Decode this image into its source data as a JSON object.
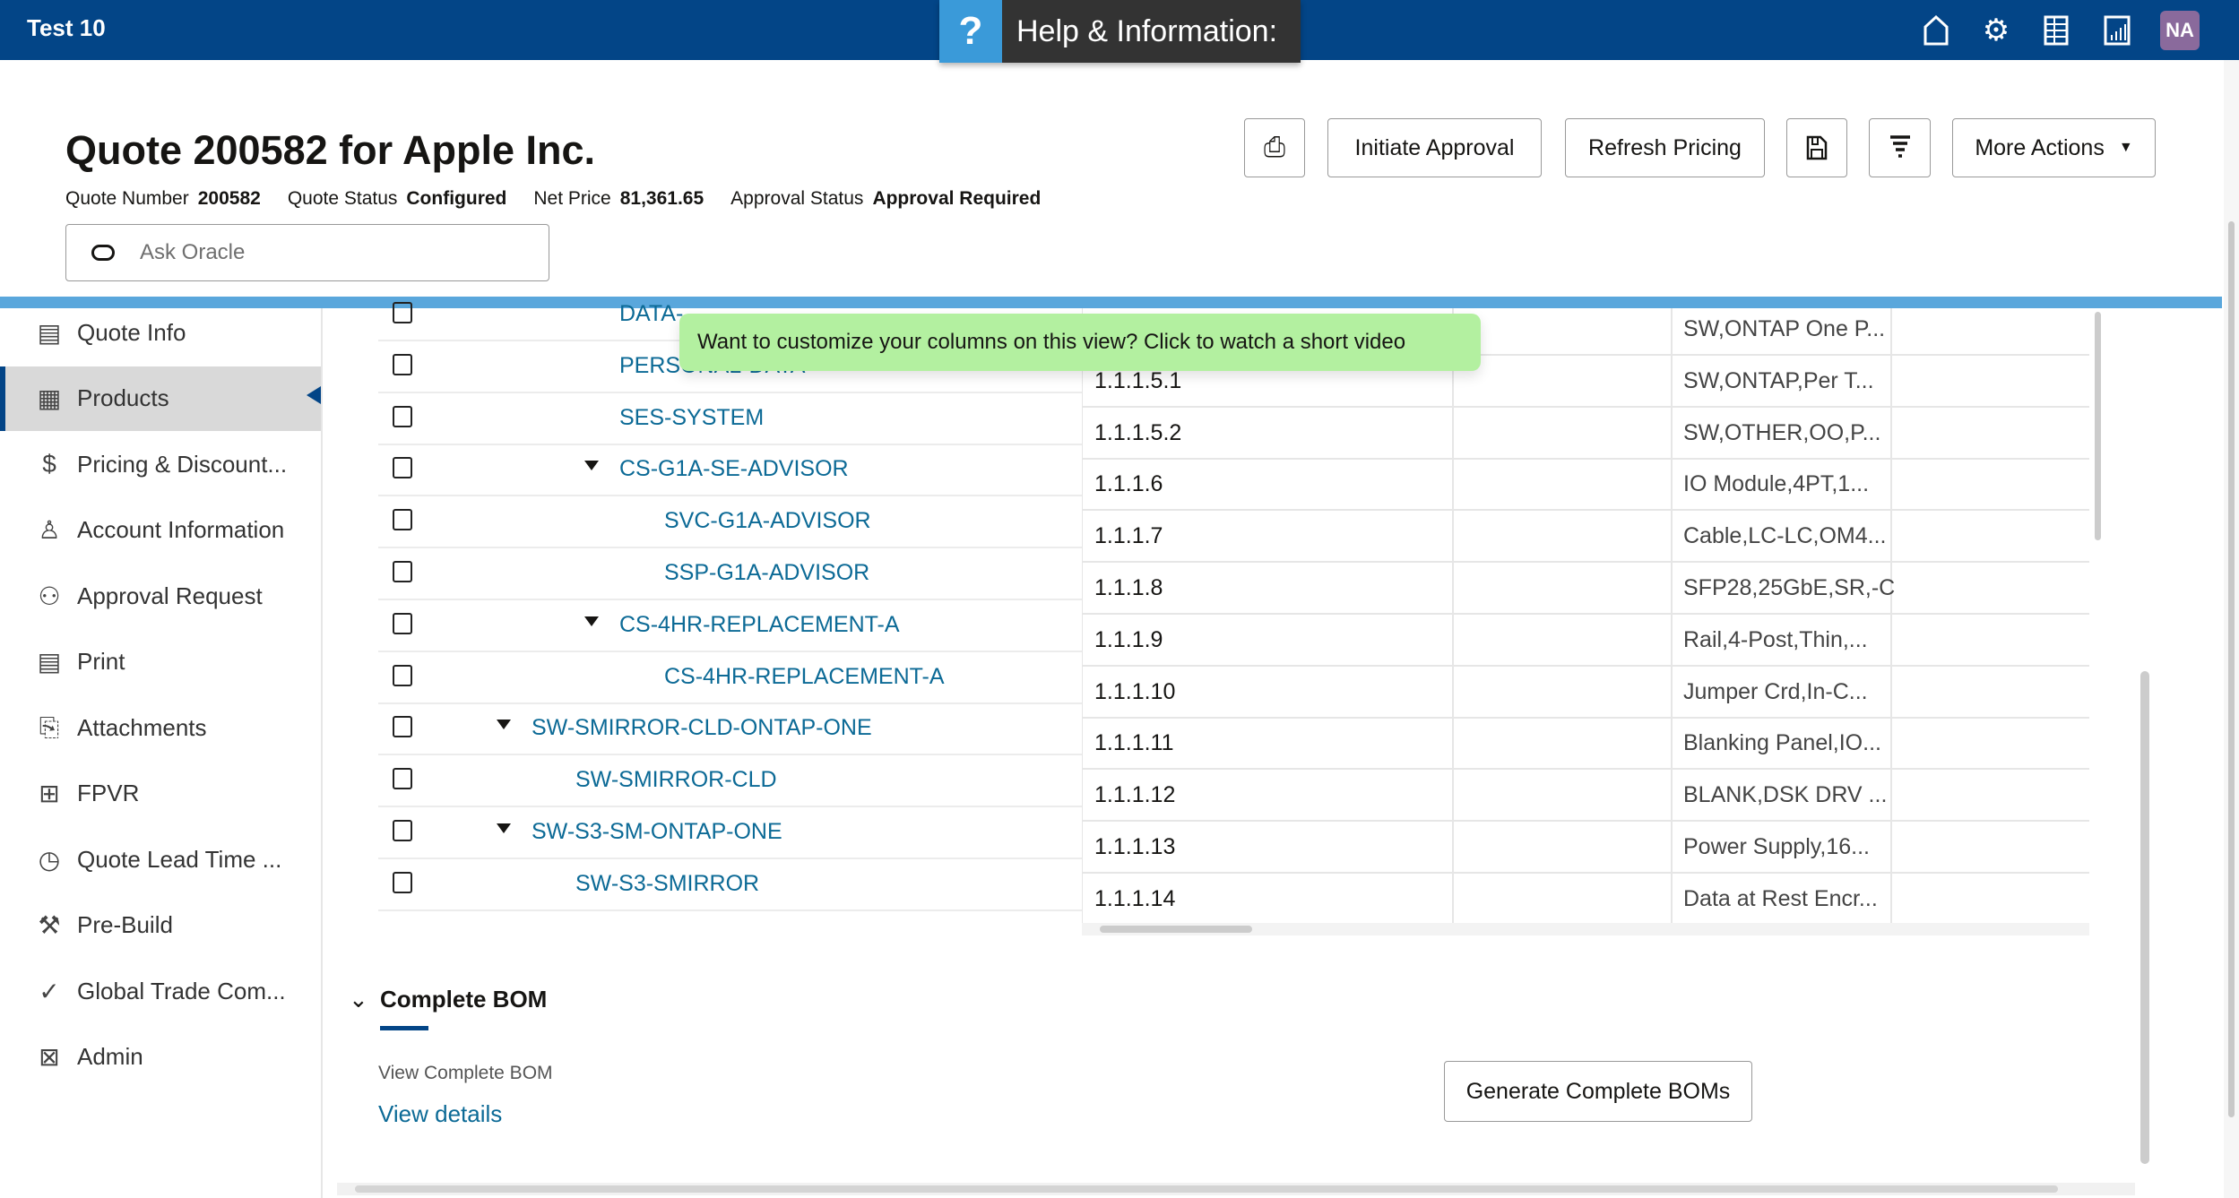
{
  "header": {
    "app_title": "Test 10",
    "help_icon": "?",
    "help_title": "Help & Information:",
    "icons": [
      "home-icon",
      "gear-icon",
      "grid-icon",
      "chart-icon"
    ],
    "avatar": "NA",
    "brand_color": "#034587"
  },
  "quote": {
    "title": "Quote 200582 for Apple Inc.",
    "meta": [
      {
        "label": "Quote Number",
        "value": "200582"
      },
      {
        "label": "Quote Status",
        "value": "Configured"
      },
      {
        "label": "Net Price",
        "value": "81,361.65"
      },
      {
        "label": "Approval Status",
        "value": "Approval Required"
      }
    ],
    "ask_placeholder": "Ask Oracle"
  },
  "toolbar": {
    "initiate": "Initiate Approval",
    "refresh": "Refresh Pricing",
    "more": "More Actions"
  },
  "sidebar": {
    "items": [
      {
        "label": "Quote Info",
        "icon": "▤"
      },
      {
        "label": "Products",
        "icon": "▦",
        "active": true
      },
      {
        "label": "Pricing & Discount...",
        "icon": "$"
      },
      {
        "label": "Account Information",
        "icon": "♙"
      },
      {
        "label": "Approval Request",
        "icon": "⚇"
      },
      {
        "label": "Print",
        "icon": "▤"
      },
      {
        "label": "Attachments",
        "icon": "⎘"
      },
      {
        "label": "FPVR",
        "icon": "⊞"
      },
      {
        "label": "Quote Lead Time ...",
        "icon": "◷"
      },
      {
        "label": "Pre-Build",
        "icon": "⚒"
      },
      {
        "label": "Global Trade Com...",
        "icon": "✓"
      },
      {
        "label": "Admin",
        "icon": "⊠"
      }
    ]
  },
  "tree": [
    {
      "name": "DATA-",
      "level": 2,
      "expand": false
    },
    {
      "name": "PERSONAL-DATA",
      "level": 2,
      "expand": false
    },
    {
      "name": "SES-SYSTEM",
      "level": 2,
      "expand": false
    },
    {
      "name": "CS-G1A-SE-ADVISOR",
      "level": 2,
      "expand": true
    },
    {
      "name": "SVC-G1A-ADVISOR",
      "level": 3,
      "expand": false
    },
    {
      "name": "SSP-G1A-ADVISOR",
      "level": 3,
      "expand": false
    },
    {
      "name": "CS-4HR-REPLACEMENT-A",
      "level": 2,
      "expand": true
    },
    {
      "name": "CS-4HR-REPLACEMENT-A",
      "level": 3,
      "expand": false
    },
    {
      "name": "SW-SMIRROR-CLD-ONTAP-ONE",
      "level": 0,
      "expand": true
    },
    {
      "name": "SW-SMIRROR-CLD",
      "level": 1,
      "expand": false
    },
    {
      "name": "SW-S3-SM-ONTAP-ONE",
      "level": 0,
      "expand": true
    },
    {
      "name": "SW-S3-SMIRROR",
      "level": 1,
      "expand": false
    }
  ],
  "grid": [
    {
      "line": "",
      "desc": "SW,ONTAP One P..."
    },
    {
      "line": "1.1.1.5.1",
      "desc": "SW,ONTAP,Per T..."
    },
    {
      "line": "1.1.1.5.2",
      "desc": "SW,OTHER,OO,P..."
    },
    {
      "line": "1.1.1.6",
      "desc": "IO Module,4PT,1..."
    },
    {
      "line": "1.1.1.7",
      "desc": "Cable,LC-LC,OM4..."
    },
    {
      "line": "1.1.1.8",
      "desc": "SFP28,25GbE,SR,-C"
    },
    {
      "line": "1.1.1.9",
      "desc": "Rail,4-Post,Thin,..."
    },
    {
      "line": "1.1.1.10",
      "desc": "Jumper Crd,In-C..."
    },
    {
      "line": "1.1.1.11",
      "desc": "Blanking Panel,IO..."
    },
    {
      "line": "1.1.1.12",
      "desc": "BLANK,DSK DRV ..."
    },
    {
      "line": "1.1.1.13",
      "desc": "Power Supply,16..."
    },
    {
      "line": "1.1.1.14",
      "desc": "Data at Rest Encr..."
    }
  ],
  "tooltip": "Want to customize your columns on this view? Click to watch a short video",
  "bom": {
    "title": "Complete BOM",
    "subtitle": "View Complete BOM",
    "link": "View details",
    "generate": "Generate Complete BOMs"
  }
}
